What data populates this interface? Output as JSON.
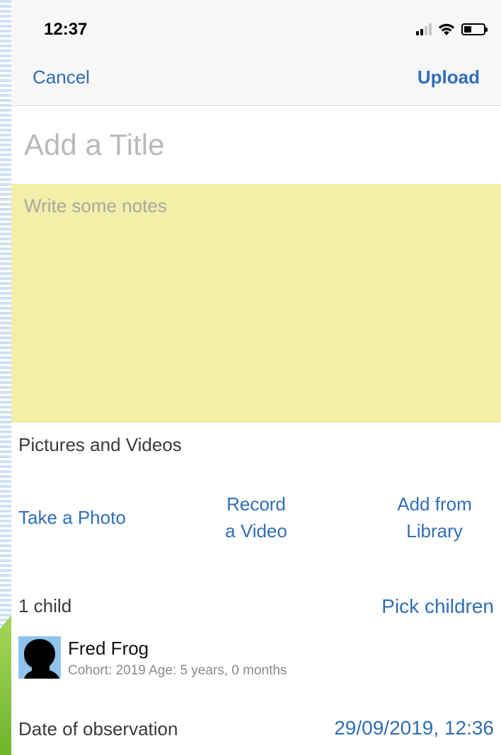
{
  "status_bar": {
    "time": "12:37",
    "icons": [
      "cellular-signal-icon",
      "wifi-icon",
      "battery-icon"
    ]
  },
  "nav": {
    "cancel_label": "Cancel",
    "upload_label": "Upload"
  },
  "form": {
    "title_placeholder": "Add a Title",
    "title_value": "",
    "notes_placeholder": "Write some notes",
    "notes_value": ""
  },
  "media": {
    "section_label": "Pictures and Videos",
    "take_photo": "Take a Photo",
    "record_video_line1": "Record",
    "record_video_line2": "a Video",
    "add_library_line1": "Add from",
    "add_library_line2": "Library"
  },
  "children": {
    "count_label": "1 child",
    "pick_label": "Pick children",
    "items": [
      {
        "name": "Fred Frog",
        "meta": "Cohort: 2019 Age: 5 years, 0 months"
      }
    ]
  },
  "observation": {
    "date_label": "Date of observation",
    "date_value": "29/09/2019, 12:36"
  },
  "colors": {
    "accent": "#2f6eb5",
    "notes_background": "#f3eea8",
    "navbar_background": "#f7f7f7",
    "avatar_background": "#8fc3ec"
  }
}
